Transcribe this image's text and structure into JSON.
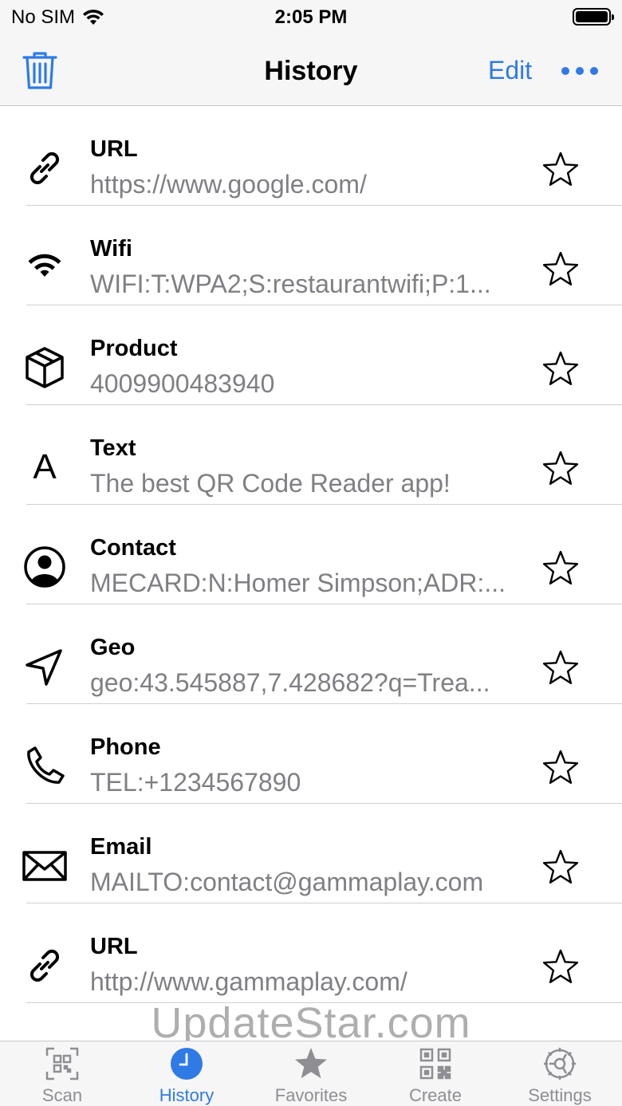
{
  "status_bar": {
    "carrier": "No SIM",
    "time": "2:05 PM"
  },
  "nav": {
    "title": "History",
    "edit_label": "Edit"
  },
  "history": [
    {
      "type": "url",
      "icon": "link-icon",
      "title": "URL",
      "value": "https://www.google.com/"
    },
    {
      "type": "wifi",
      "icon": "wifi-icon",
      "title": "Wifi",
      "value": "WIFI:T:WPA2;S:restaurantwifi;P:1..."
    },
    {
      "type": "product",
      "icon": "box-icon",
      "title": "Product",
      "value": "4009900483940"
    },
    {
      "type": "text",
      "icon": "text-icon",
      "title": "Text",
      "value": "The best QR Code Reader app!",
      "glyph": "A"
    },
    {
      "type": "contact",
      "icon": "person-circle-icon",
      "title": "Contact",
      "value": "MECARD:N:Homer Simpson;ADR:..."
    },
    {
      "type": "geo",
      "icon": "location-arrow-icon",
      "title": "Geo",
      "value": "geo:43.545887,7.428682?q=Trea..."
    },
    {
      "type": "phone",
      "icon": "phone-icon",
      "title": "Phone",
      "value": "TEL:+1234567890"
    },
    {
      "type": "email",
      "icon": "envelope-icon",
      "title": "Email",
      "value": "MAILTO:contact@gammaplay.com"
    },
    {
      "type": "url",
      "icon": "link-icon",
      "title": "URL",
      "value": "http://www.gammaplay.com/"
    }
  ],
  "watermark": "UpdateStar.com",
  "tabs": [
    {
      "id": "scan",
      "label": "Scan",
      "icon": "qr-scan-icon",
      "active": false
    },
    {
      "id": "history",
      "label": "History",
      "icon": "clock-icon",
      "active": true
    },
    {
      "id": "favorites",
      "label": "Favorites",
      "icon": "star-icon",
      "active": false
    },
    {
      "id": "create",
      "label": "Create",
      "icon": "qr-code-icon",
      "active": false
    },
    {
      "id": "settings",
      "label": "Settings",
      "icon": "gear-icon",
      "active": false
    }
  ],
  "colors": {
    "accent": "#2f7ae5",
    "secondary_text": "#7f7f84",
    "tab_inactive": "#8e8e93",
    "bar_bg": "#f6f6f7"
  }
}
